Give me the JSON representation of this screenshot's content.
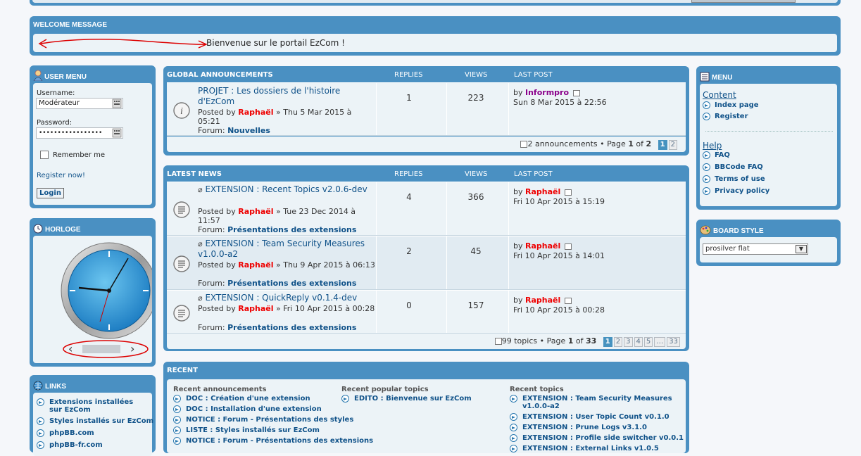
{
  "welcome": {
    "header": "WELCOME MESSAGE",
    "text": "Bienvenue sur le portail EzCom !"
  },
  "user_menu": {
    "header": "USER MENU",
    "username_label": "Username:",
    "username_value": "Modérateur",
    "password_label": "Password:",
    "password_value": "•••••••••••••••••",
    "remember_label": "Remember me",
    "register_link": "Register now!",
    "login_button": "Login"
  },
  "clock": {
    "header": "HORLOGE"
  },
  "links": {
    "header": "LINKS",
    "items": [
      "Extensions installées sur EzCom",
      "Styles installés sur EzCom",
      "phpBB.com",
      "phpBB-fr.com"
    ]
  },
  "global_announcements": {
    "header": "GLOBAL ANNOUNCEMENTS",
    "col_replies": "REPLIES",
    "col_views": "VIEWS",
    "col_last_post": "LAST POST",
    "rows": [
      {
        "title": "PROJET : Les dossiers de l'histoire d'EzCom",
        "posted_by_label": "Posted by",
        "author": "Raphaël",
        "date": "» Thu 5 Mar 2015 à 05:21",
        "forum_label": "Forum:",
        "forum": "Nouvelles",
        "replies": "1",
        "views": "223",
        "lp_by": "by",
        "lp_author": "Informpro",
        "lp_date": "Sun 8 Mar 2015 à 22:56"
      }
    ],
    "pagination_text": "2 announcements • Page",
    "page_current": "1",
    "page_of": "of",
    "page_total": "2",
    "pages": [
      "1",
      "2"
    ]
  },
  "latest_news": {
    "header": "LATEST NEWS",
    "col_replies": "REPLIES",
    "col_views": "VIEWS",
    "col_last_post": "LAST POST",
    "rows": [
      {
        "title": "EXTENSION : Recent Topics v2.0.6-dev",
        "posted_by_label": "Posted by",
        "author": "Raphaël",
        "date": "» Tue 23 Dec 2014 à 11:57",
        "forum_label": "Forum:",
        "forum": "Présentations des extensions",
        "replies": "4",
        "views": "366",
        "lp_by": "by",
        "lp_author": "Raphaël",
        "lp_date": "Fri 10 Apr 2015 à 15:19"
      },
      {
        "title": "EXTENSION : Team Security Measures v1.0.0-a2",
        "posted_by_label": "Posted by",
        "author": "Raphaël",
        "date": "» Thu 9 Apr 2015 à 06:13",
        "forum_label": "Forum:",
        "forum": "Présentations des extensions",
        "replies": "2",
        "views": "45",
        "lp_by": "by",
        "lp_author": "Raphaël",
        "lp_date": "Fri 10 Apr 2015 à 14:01"
      },
      {
        "title": "EXTENSION : QuickReply v0.1.4-dev",
        "posted_by_label": "Posted by",
        "author": "Raphaël",
        "date": "» Fri 10 Apr 2015 à 00:28",
        "forum_label": "Forum:",
        "forum": "Présentations des extensions",
        "replies": "0",
        "views": "157",
        "lp_by": "by",
        "lp_author": "Raphaël",
        "lp_date": "Fri 10 Apr 2015 à 00:28"
      }
    ],
    "pagination_text": "99 topics • Page",
    "page_current": "1",
    "page_of": "of",
    "page_total": "33",
    "pages": [
      "1",
      "2",
      "3",
      "4",
      "5",
      "…",
      "33"
    ]
  },
  "recent": {
    "header": "RECENT",
    "announcements_head": "Recent announcements",
    "announcements": [
      "DOC : Création d'une extension",
      "DOC : Installation d'une extension",
      "NOTICE : Forum - Présentations des styles",
      "LISTE : Styles installés sur EzCom",
      "NOTICE : Forum - Présentations des extensions"
    ],
    "popular_head": "Recent popular topics",
    "popular": [
      "EDITO : Bienvenue sur EzCom"
    ],
    "topics_head": "Recent topics",
    "topics": [
      "EXTENSION : Team Security Measures v1.0.0-a2",
      "EXTENSION : User Topic Count v0.1.0",
      "EXTENSION : Prune Logs v3.1.0",
      "EXTENSION : Profile side switcher v0.0.1",
      "EXTENSION : External Links v1.0.5"
    ]
  },
  "menu": {
    "header": "MENU",
    "content_head": "Content",
    "content_items": [
      "Index page",
      "Register"
    ],
    "help_head": "Help",
    "help_items": [
      "FAQ",
      "BBCode FAQ",
      "Terms of use",
      "Privacy policy"
    ]
  },
  "board_style": {
    "header": "BOARD STYLE",
    "selected": "prosilver flat"
  },
  "colors": {
    "panel": "#4a90c2",
    "panel_body": "#ecf3f7",
    "link": "#105289",
    "author_red": "#ee0000",
    "author_purple": "#8b008b",
    "annotation_red": "#dd0000"
  }
}
